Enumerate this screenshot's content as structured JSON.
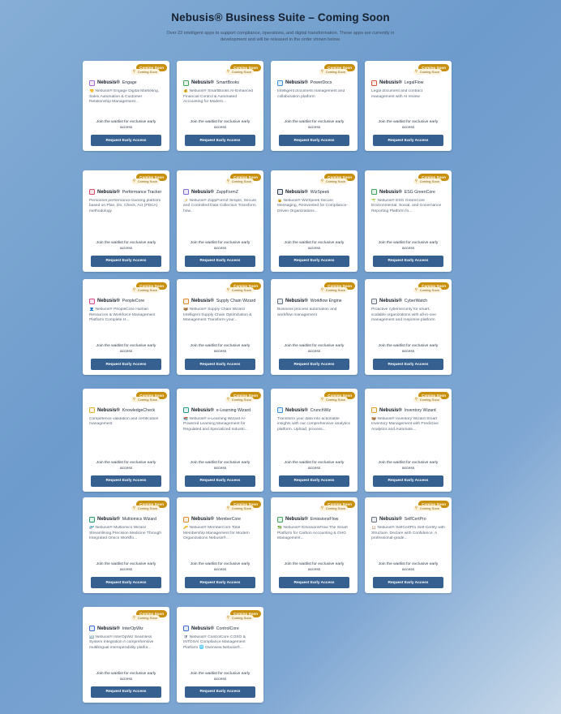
{
  "header": {
    "title": "Nebusis® Business Suite – Coming Soon",
    "subtitle": "Over 22 intelligent apps to support compliance, operations, and digital transformation. These apps are currently in development and will be released in the order shown below."
  },
  "common": {
    "badge": "Coming Soon",
    "badge_ghost": "Coming Soon",
    "brand": "Nebusis®",
    "waitlist": "Join the waitlist for exclusive early access",
    "button": "Request Early Access"
  },
  "colors": {
    "badge": "#c9900d",
    "button": "#35608f",
    "accent_icon": "#7b6cd9"
  },
  "apps": [
    {
      "name": "Engage",
      "icon": "people-icon",
      "color": "#a66ad9",
      "desc": "👏 Nebusis® Engage Digital Marketing, Sales Automation & Customer Relationship Management..."
    },
    {
      "name": "SmartBooks",
      "icon": "ledger-icon",
      "color": "#3fa45a",
      "desc": "💰 Nebusis® SmartBooks AI-Enhanced Financial Control & Automated Accounting for Modern..."
    },
    {
      "name": "PowerDocs",
      "icon": "document-icon",
      "color": "#3f8fd6",
      "desc": "Intelligent document management and collaboration platform"
    },
    {
      "name": "LegalFlow",
      "icon": "gavel-icon",
      "color": "#d9573f",
      "desc": "Legal document and contract management with AI review"
    },
    {
      "name": "Performance Tracker",
      "icon": "trend-icon",
      "color": "#d94a6a",
      "desc": "Personnel performance tracking platform based on Plan, Do, Check, Act (PDCA) methodology"
    },
    {
      "name": "ZappFormZ",
      "icon": "form-icon",
      "color": "#7b6cd9",
      "desc": "📝 Nebusis® ZappFormZ Simple, Secure and Controlled Data Collection Transform how..."
    },
    {
      "name": "WizSpeek",
      "icon": "chat-icon",
      "color": "#2d3e57",
      "desc": "🔒 Nebusis® WizSpeek Secure Messaging, Reinvented for Compliance-Driven Organizations..."
    },
    {
      "name": "ESG GreenCore",
      "icon": "leaf-icon",
      "color": "#3fa45a",
      "desc": "🌱 Nebusis® ESG GreenCore Environmental, Social, and Governance Reporting Platform fo..."
    },
    {
      "name": "PeopleCore",
      "icon": "people-icon",
      "color": "#d94a8a",
      "desc": "👤 Nebusis® PeopleCore Human Resources & Workforce Management Platform Complete H..."
    },
    {
      "name": "Supply Chain Wizard",
      "icon": "truck-icon",
      "color": "#e08a2a",
      "desc": "📦 Nebusis® Supply Chain Wizard Intelligent Supply Chain Optimization & Management Transform your..."
    },
    {
      "name": "Workflow Engine",
      "icon": "gear-icon",
      "color": "#6a7485",
      "desc": "Business process automation and workflow management"
    },
    {
      "name": "CyberWatch",
      "icon": "clock-icon",
      "color": "#6a7485",
      "desc": "Proactive cybersecurity for smart, scalable organizations with all-in-one management and response platform"
    },
    {
      "name": "KnowledgeCheck",
      "icon": "check-icon",
      "color": "#e0b02a",
      "desc": "Competence validation and certification management"
    },
    {
      "name": "e-Learning Wizard",
      "icon": "graduation-cap-icon",
      "color": "#2a9a8a",
      "desc": "📚 Nebusis® e-Learning Wizard AI-Powered Learning Management for Regulated and Specialized Industri..."
    },
    {
      "name": "CrunchWiz",
      "icon": "chart-icon",
      "color": "#3f8fd6",
      "desc": "Transform your data into actionable insights with our comprehensive analytics platform. Upload, process..."
    },
    {
      "name": "Inventory Wizard",
      "icon": "box-icon",
      "color": "#e0a02a",
      "desc": "📦 Nebusis® Inventory Wizard Smart Inventory Management with Predictive Analytics and Automate..."
    },
    {
      "name": "Multiomics Wizard",
      "icon": "flask-icon",
      "color": "#2a9a6a",
      "desc": "🧬 Nebusis® Multiomics Wizard Streamlining Precision Medicine Through Integrated Omics Workflo..."
    },
    {
      "name": "MemberCore",
      "icon": "people-icon",
      "color": "#e08a2a",
      "desc": "🔑 Nebusis® MemberCore Total Membership Management for Modern Organizations Nebusis®..."
    },
    {
      "name": "EmissionsFlow",
      "icon": "leaf-icon",
      "color": "#3fa45a",
      "desc": "🌿 Nebusis® EmissionsFlow The Smart Platform for Carbon Accounting & GHG Management..."
    },
    {
      "name": "SelfCertPro",
      "icon": "ribbon-icon",
      "color": "#6a7485",
      "desc": "📋 Nebusis® SelfCertPro Self-Certify with Structure. Declare with Confidence. A professional-grade..."
    },
    {
      "name": "InterOpWiz",
      "icon": "network-icon",
      "color": "#3f6fd6",
      "desc": "🔄 Nebusis® InterOpWiz Seamless System Integration A comprehensive multilingual interoperability platfor..."
    },
    {
      "name": "ControlCore",
      "icon": "shield-icon",
      "color": "#3f6fd6",
      "desc": "🛡 Nebusis® ControlCore COSO & INTOSAI Compliance Management Platform 🌐 Overview Nebusis®..."
    }
  ]
}
